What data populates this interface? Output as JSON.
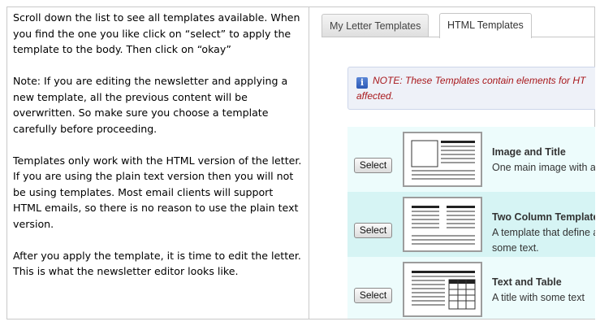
{
  "instructions": {
    "p1": "Scroll down the list to see all templates available. When you find the one you like click on “select” to apply the template to the body. Then click on “okay”",
    "p2": "Note: If you are editing the newsletter and applying a new template, all the previous content will be overwritten. So make sure you choose a template carefully before proceeding.",
    "p3": "Templates only work with the HTML version of the letter. If you are using the plain text version then you will not be using templates. Most email clients will support HTML emails, so there is no reason to use the plain text version.",
    "p4": "After you apply the template, it is time to edit the letter. This is what the newsletter editor looks like."
  },
  "tabs": {
    "my_letter": "My Letter Templates",
    "html": "HTML Templates",
    "active": "html"
  },
  "note": {
    "icon": "info-icon",
    "line1": "NOTE: These Templates contain elements for HT",
    "line2": "affected.",
    "color": "#a8181c"
  },
  "templates": [
    {
      "select_label": "Select",
      "title": "Image and Title",
      "description": "One main image with a",
      "thumb": "image-and-title"
    },
    {
      "select_label": "Select",
      "title": "Two Column Template",
      "description": "A template that define and some text.",
      "thumb": "two-column"
    },
    {
      "select_label": "Select",
      "title": "Text and Table",
      "description": "A title with some text",
      "thumb": "text-and-table"
    }
  ],
  "colors": {
    "row_light": "#edfcfc",
    "row_dark": "#d6f4f4",
    "note_bg": "#eef1f8"
  }
}
